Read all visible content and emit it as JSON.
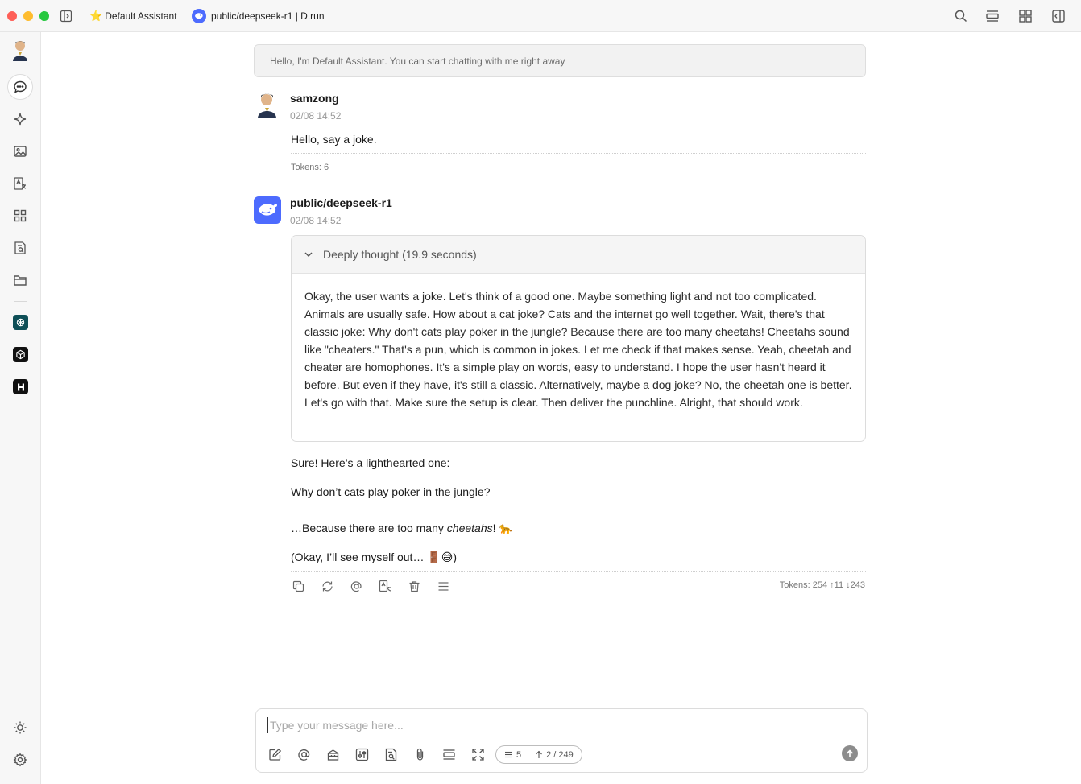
{
  "window": {
    "tabs": [
      {
        "label": "Default Assistant",
        "icon": "star-icon"
      },
      {
        "label": "public/deepseek-r1 | D.run",
        "icon": "deepseek-logo-icon"
      }
    ],
    "toolbar_icons": [
      "search-icon",
      "topic-panel-icon",
      "grid-icon",
      "right-sidebar-icon"
    ]
  },
  "rail": {
    "items": [
      "chat-icon",
      "sparkle-icon",
      "image-icon",
      "translate-icon",
      "apps-icon",
      "knowledge-icon",
      "folder-icon"
    ],
    "mini_apps": [
      "openai-app-icon",
      "cube-app-icon",
      "h-app-icon"
    ],
    "bottom": [
      "theme-sun-icon",
      "settings-gear-icon"
    ]
  },
  "welcome": {
    "text": "Hello, I'm Default Assistant. You can start chatting with me right away"
  },
  "messages": {
    "user": {
      "name": "samzong",
      "time": "02/08 14:52",
      "text": "Hello, say a joke.",
      "tokens": "Tokens: 6"
    },
    "assistant": {
      "name": "public/deepseek-r1",
      "time": "02/08 14:52",
      "thinking_label": "Deeply thought (19.9 seconds)",
      "thinking_text": "Okay, the user wants a joke. Let's think of a good one. Maybe something light and not too complicated. Animals are usually safe. How about a cat joke? Cats and the internet go well together. Wait, there's that classic joke: Why don't cats play poker in the jungle? Because there are too many cheetahs! Cheetahs sound like \"cheaters.\" That's a pun, which is common in jokes. Let me check if that makes sense. Yeah, cheetah and cheater are homophones. It's a simple play on words, easy to understand. I hope the user hasn't heard it before. But even if they have, it's still a classic. Alternatively, maybe a dog joke? No, the cheetah one is better. Let's go with that. Make sure the setup is clear. Then deliver the punchline. Alright, that should work.",
      "answer_line1": "Sure! Here’s a lighthearted one:",
      "answer_line2": "Why don’t cats play poker in the jungle?",
      "answer_line3_prefix": "…Because there are too many ",
      "answer_line3_italic": "cheetahs",
      "answer_line3_suffix": "! 🐆",
      "answer_line4": "(Okay, I’ll see myself out… 🚪😅)",
      "tokens": "Tokens: 254 ↑11 ↓243",
      "actions": [
        "copy-icon",
        "regenerate-icon",
        "mention-icon",
        "translate-icon",
        "delete-icon",
        "menu-icon"
      ]
    }
  },
  "composer": {
    "placeholder": "Type your message here...",
    "context_count": "5",
    "token_usage": "2 / 249",
    "tools": [
      "new-topic-icon",
      "mention-icon",
      "prompt-library-icon",
      "settings-sliders-icon",
      "knowledge-icon",
      "attachment-icon",
      "clear-icon",
      "expand-icon"
    ]
  }
}
